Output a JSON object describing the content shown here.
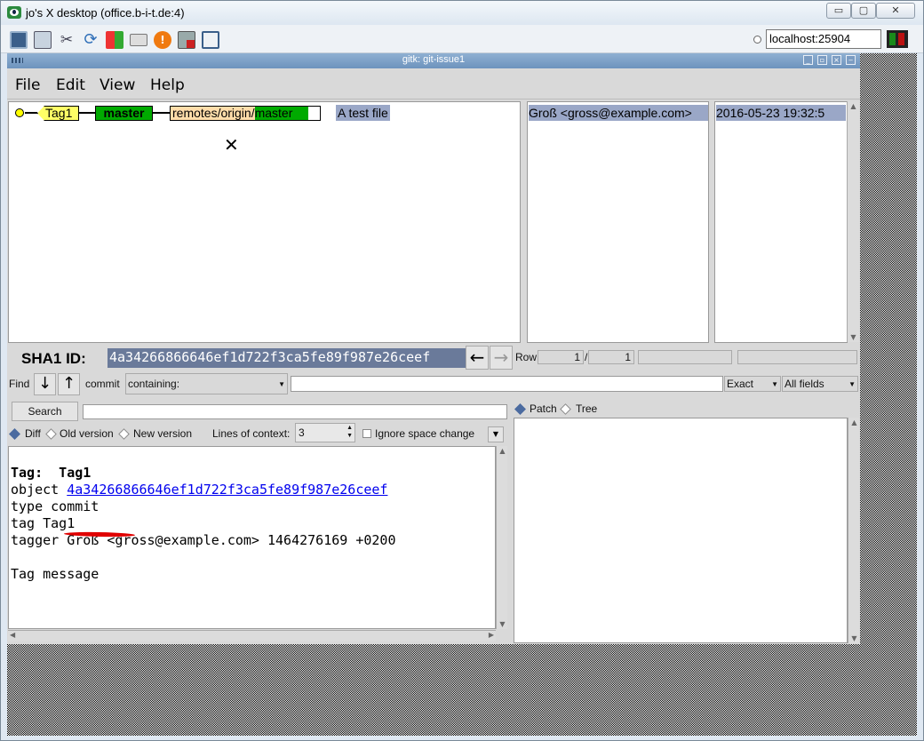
{
  "vnc": {
    "title": "jo's X desktop (office.b-i-t.de:4)",
    "host": "localhost:25904",
    "buttons": {
      "minimize": "▭",
      "maximize": "▢",
      "close": "✕"
    },
    "toolbar_icons": [
      "monitor-icon",
      "copy-icon",
      "tools-icon",
      "refresh-icon",
      "windows-icon",
      "keyboard-icon",
      "alert-icon",
      "disconnect-icon",
      "fullscreen-icon"
    ]
  },
  "gitk": {
    "title": "gitk: git-issue1",
    "menu": [
      "File",
      "Edit",
      "View",
      "Help"
    ],
    "refs": {
      "tag": "Tag1",
      "branch": "master",
      "remote_prefix": "remotes/origin/",
      "remote_branch": "master"
    },
    "commit_subject": "A test file",
    "author": "Groß <gross@example.com>",
    "date": "2016-05-23 19:32:5",
    "sha_label": "SHA1 ID:",
    "sha": "4a34266866646ef1d722f3ca5fe89f987e26ceef",
    "row_label": "Row",
    "row_current": "1",
    "row_sep": "/",
    "row_total": "1",
    "find_label": "Find",
    "commit_label": "commit",
    "containing": "containing:",
    "exact": "Exact",
    "all_fields": "All fields",
    "search": "Search",
    "diff": "Diff",
    "old_version": "Old version",
    "new_version": "New version",
    "lines_label": "Lines of context:",
    "lines_value": "3",
    "ignore_space": "Ignore space change",
    "patch": "Patch",
    "tree": "Tree",
    "details": {
      "tag_line": "Tag:  Tag1",
      "object_prefix": "object ",
      "object_sha": "4a34266866646ef1d722f3ca5fe89f987e26ceef",
      "type_line": "type commit",
      "tag2_line": "tag Tag1",
      "tagger_prefix": "tagger ",
      "tagger_name": "Groß",
      "tagger_rest": " <gross@example.com> 1464276169 +0200",
      "message": "Tag message"
    },
    "colors": {
      "tag": "#ffff66",
      "branch": "#00aa00",
      "remote": "#ffddaa",
      "selection": "#9aa7c7",
      "link": "#0000ee",
      "annotation": "#e00000"
    }
  }
}
